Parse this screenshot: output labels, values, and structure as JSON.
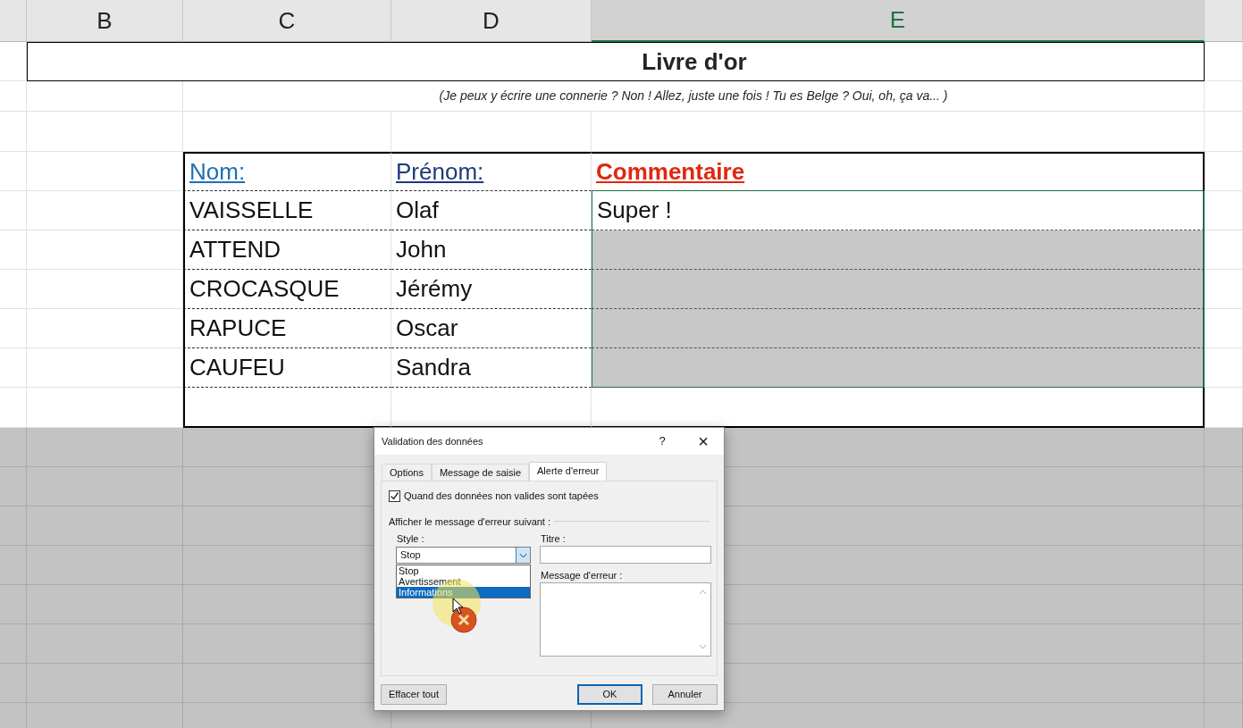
{
  "columns": [
    {
      "label": "B",
      "selected": false
    },
    {
      "label": "C",
      "selected": false
    },
    {
      "label": "D",
      "selected": false
    },
    {
      "label": "E",
      "selected": true
    }
  ],
  "title": "Livre d'or",
  "subtitle": "(Je peux y écrire une connerie ? Non ! Allez, juste une fois ! Tu es Belge ? Oui, oh, ça va... )",
  "table": {
    "headers": [
      {
        "text": "Nom:",
        "color": "#1f6fb5"
      },
      {
        "text": "Prénom:",
        "color": "#1f3a7a"
      },
      {
        "text": "Commentaire",
        "color": "#e0280e"
      }
    ],
    "rows": [
      {
        "nom": "VAISSELLE",
        "prenom": "Olaf",
        "commentaire": "Super !",
        "shaded": false
      },
      {
        "nom": "ATTEND",
        "prenom": "John",
        "shaded": true
      },
      {
        "nom": "CROCASQUE",
        "prenom": "Jérémy",
        "shaded": true
      },
      {
        "nom": "RAPUCE",
        "prenom": "Oscar",
        "shaded": true
      },
      {
        "nom": "CAUFEU",
        "prenom": "Sandra",
        "shaded": true
      }
    ]
  },
  "dialog": {
    "title": "Validation des données",
    "help": "?",
    "close": "×",
    "tabs": [
      {
        "label": "Options",
        "selected": false
      },
      {
        "label": "Message de saisie",
        "selected": false
      },
      {
        "label": "Alerte d'erreur",
        "selected": true
      }
    ],
    "checkbox": {
      "label": "Quand des données non valides sont tapées",
      "checked": true
    },
    "section": "Afficher le message d'erreur suivant :",
    "style_label": "Style :",
    "style_value": "Stop",
    "style_options": [
      {
        "label": "Stop",
        "selected": false
      },
      {
        "label": "Avertissement",
        "selected": false
      },
      {
        "label": "Informations",
        "selected": true
      }
    ],
    "titre_label": "Titre :",
    "message_label": "Message d'erreur :",
    "buttons": [
      {
        "label": "Effacer tout",
        "kind": "left"
      },
      {
        "label": "OK",
        "kind": "default"
      },
      {
        "label": "Annuler",
        "kind": "normal"
      }
    ]
  }
}
